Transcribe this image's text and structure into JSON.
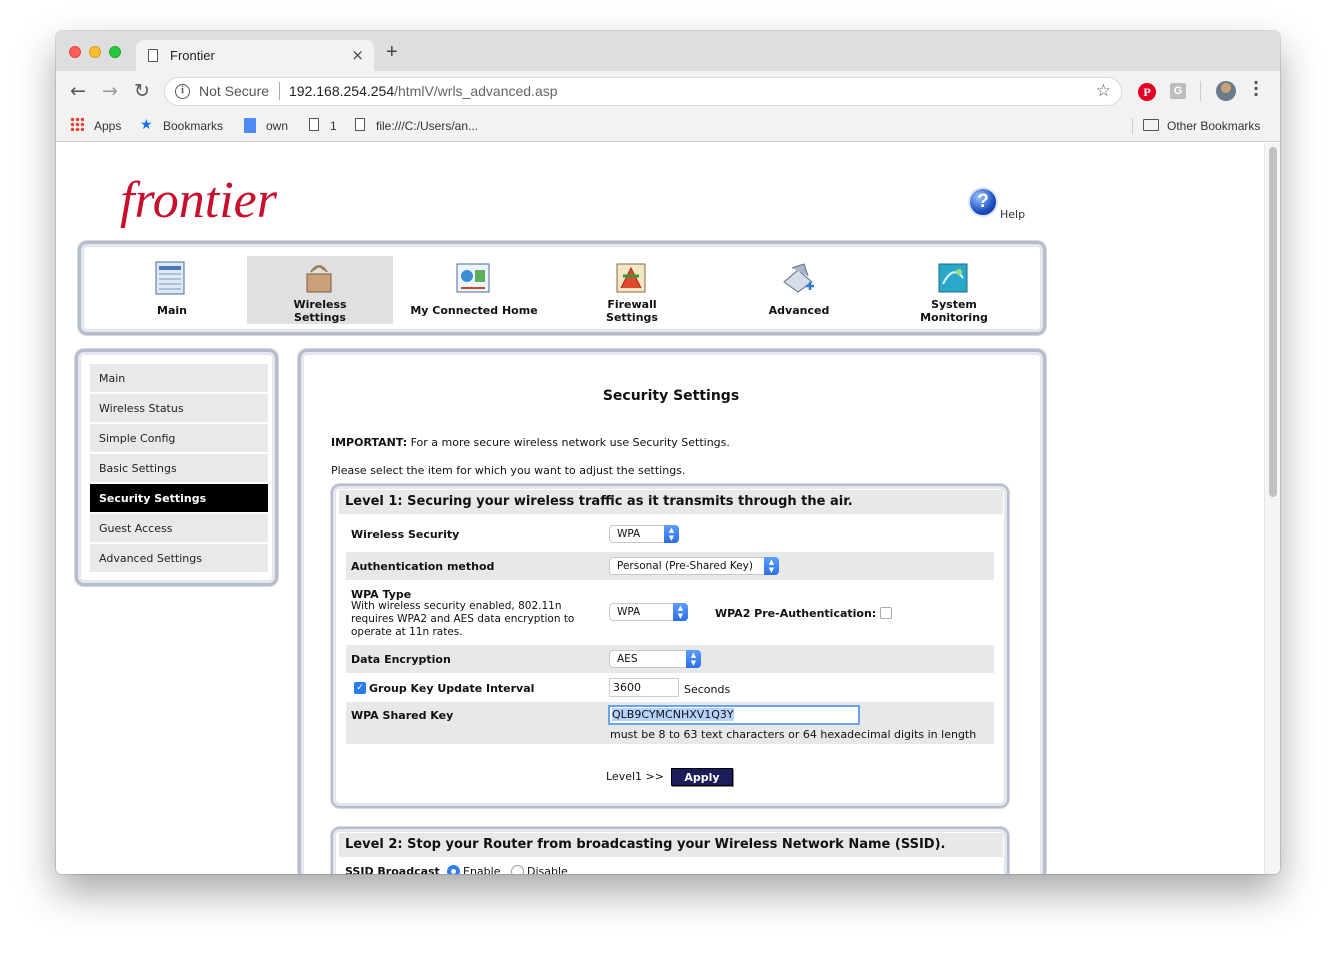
{
  "browser": {
    "tab_title": "Frontier",
    "new_tab": "+",
    "close": "×",
    "security_label": "Not Secure",
    "url_host": "192.168.254.254",
    "url_path": "/htmlV/wrls_advanced.asp",
    "extension_g": "G",
    "extension_p": "P",
    "info_glyph": "i"
  },
  "bookmarks_bar": {
    "apps": "Apps",
    "bookmarks": "Bookmarks",
    "own": "own",
    "one": "1",
    "file": "file:///C:/Users/an...",
    "other": "Other Bookmarks"
  },
  "page": {
    "logo": "frontier",
    "help": "Help",
    "help_glyph": "?",
    "top_nav": [
      {
        "line1": "Main",
        "line2": ""
      },
      {
        "line1": "Wireless",
        "line2": "Settings"
      },
      {
        "line1": "My Connected Home",
        "line2": ""
      },
      {
        "line1": "Firewall",
        "line2": "Settings"
      },
      {
        "line1": "Advanced",
        "line2": ""
      },
      {
        "line1": "System",
        "line2": "Monitoring"
      }
    ],
    "side_nav": [
      "Main",
      "Wireless Status",
      "Simple Config",
      "Basic Settings",
      "Security Settings",
      "Guest Access",
      "Advanced Settings"
    ],
    "title": "Security Settings",
    "important_label": "IMPORTANT:",
    "important_text": "For a more secure wireless network use Security Settings.",
    "instruction": "Please select the item for which you want to adjust the settings.",
    "level1": {
      "heading": "Level 1: Securing your wireless traffic as it transmits through the air.",
      "wireless_security_label": "Wireless Security",
      "wireless_security_value": "WPA",
      "auth_label": "Authentication method",
      "auth_value": "Personal (Pre-Shared Key)",
      "wpa_type_label": "WPA Type",
      "wpa_type_help": "With wireless security enabled, 802.11n requires WPA2 and AES data encryption to operate at 11n rates.",
      "wpa_type_value": "WPA",
      "preauth_label": "WPA2 Pre-Authentication:",
      "encryption_label": "Data Encryption",
      "encryption_value": "AES",
      "group_key_label": "Group Key Update Interval",
      "group_key_value": "3600",
      "group_key_unit": "Seconds",
      "shared_key_label": "WPA Shared Key",
      "shared_key_value": "QLB9CYMCNHXV1Q3Y",
      "shared_key_hint": "must be 8 to 63 text characters or 64 hexadecimal digits in length",
      "apply_prefix": "Level1 >>",
      "apply_label": "Apply"
    },
    "level2": {
      "heading": "Level 2: Stop your Router from broadcasting your Wireless Network Name (SSID).",
      "ssid_label": "SSID Broadcast",
      "enable": "Enable",
      "disable": "Disable"
    }
  }
}
